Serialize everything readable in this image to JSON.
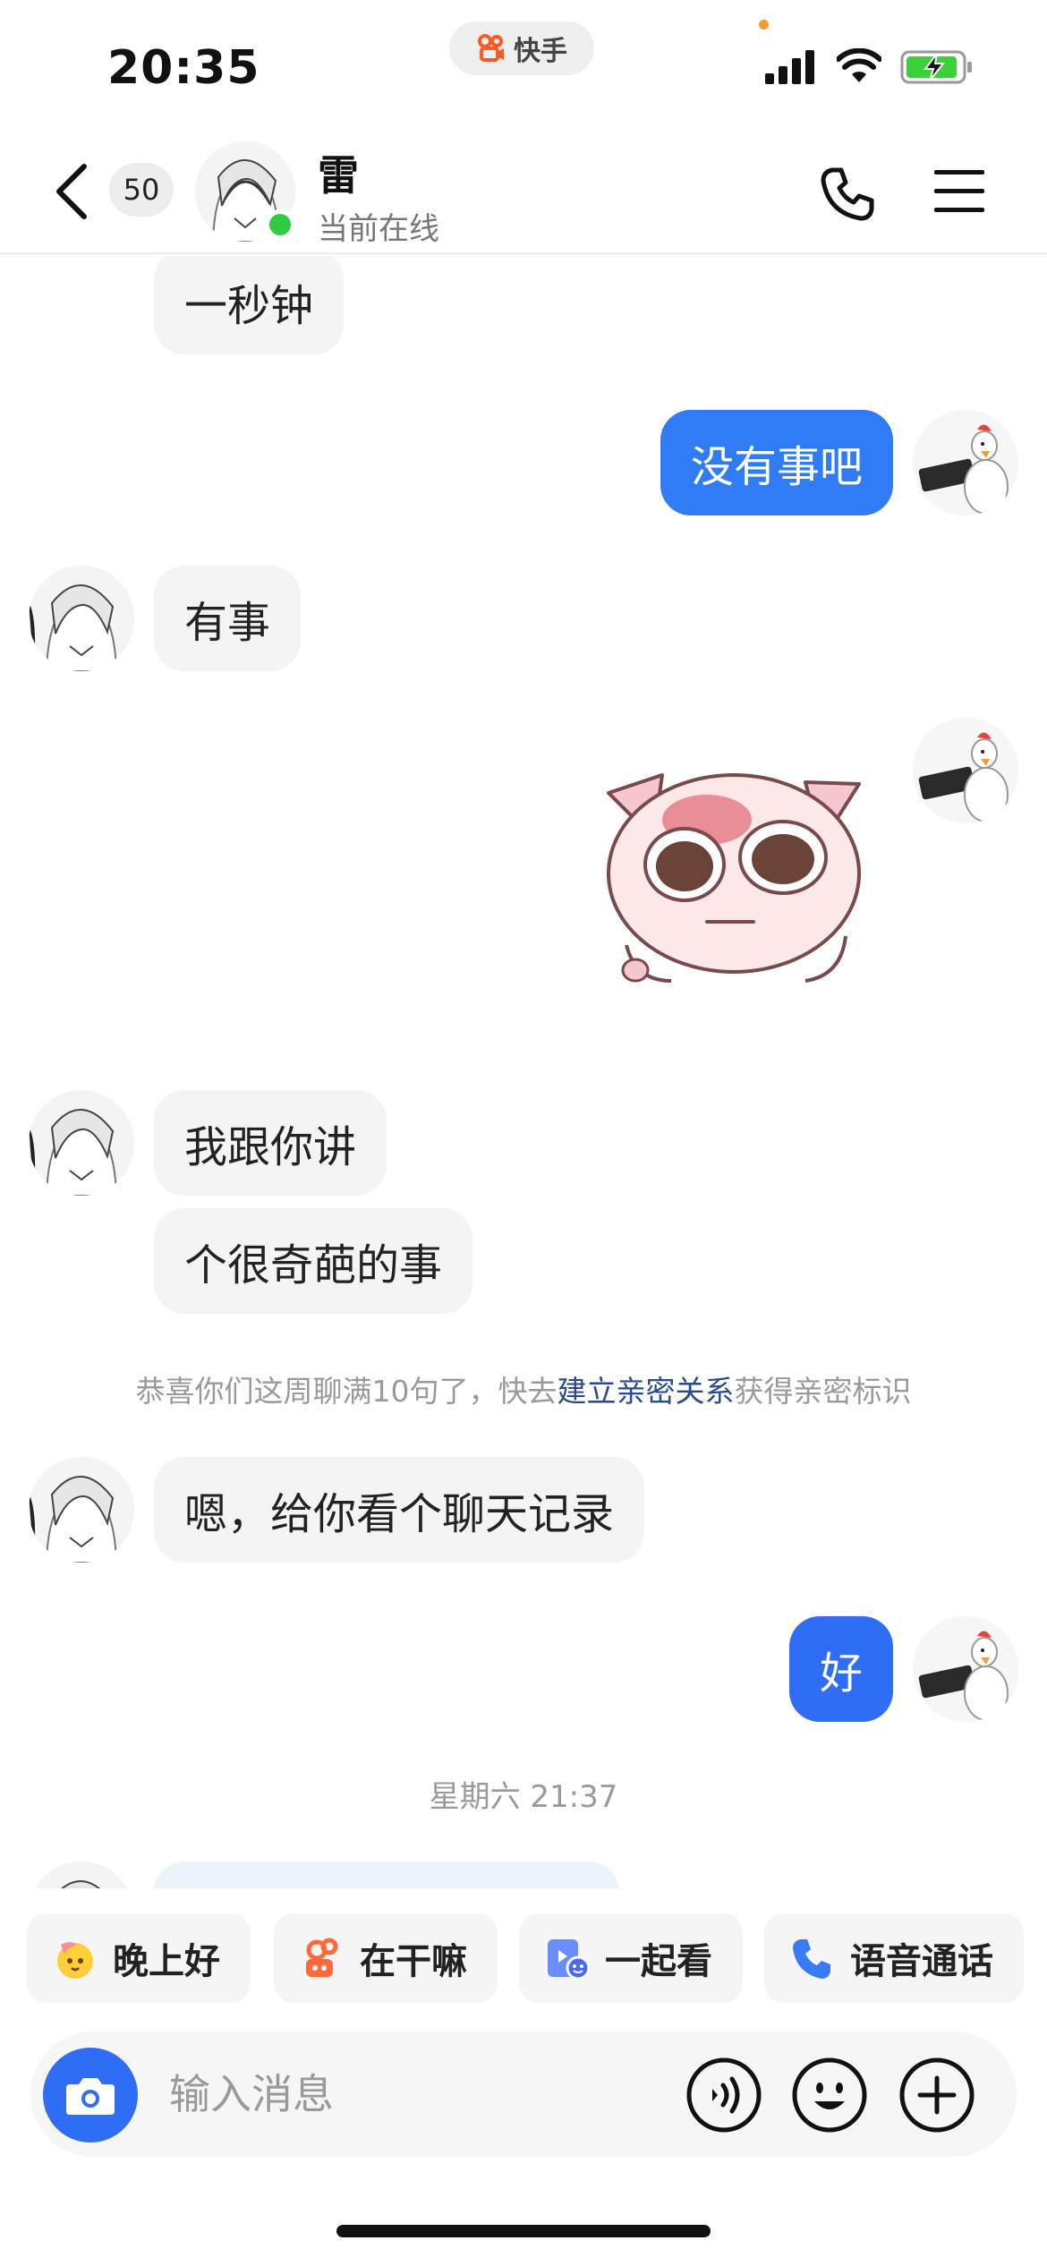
{
  "status_bar": {
    "time": "20:35",
    "app_name": "快手",
    "battery": "charging"
  },
  "header": {
    "unread_count": "50",
    "contact_name": "雷",
    "presence": "当前在线"
  },
  "messages": [
    {
      "side": "in",
      "text": "一秒钟"
    },
    {
      "side": "out",
      "text": "没有事吧"
    },
    {
      "side": "in",
      "text": "有事"
    },
    {
      "side": "out",
      "type": "sticker",
      "sticker_name": "pink-cat-sticker"
    },
    {
      "side": "in",
      "text": "我跟你讲"
    },
    {
      "side": "in",
      "text": "个很奇葩的事"
    },
    {
      "side": "in",
      "text": "嗯，给你看个聊天记录"
    },
    {
      "side": "out",
      "text": "好"
    }
  ],
  "notice": {
    "prefix": "恭喜你们这周聊满10句了，快去",
    "link": "建立亲密关系",
    "suffix": "获得亲密标识"
  },
  "timestamp": "星期六 21:37",
  "quick_replies": [
    {
      "label": "晚上好",
      "icon": "moon-face-icon"
    },
    {
      "label": "在干嘛",
      "icon": "flower-icon"
    },
    {
      "label": "一起看",
      "icon": "watch-together-icon"
    },
    {
      "label": "语音通话",
      "icon": "phone-icon"
    }
  ],
  "input": {
    "placeholder": "输入消息"
  },
  "colors": {
    "accent": "#2f7cf6",
    "online": "#2ecc40",
    "link": "#2a4a8f"
  }
}
